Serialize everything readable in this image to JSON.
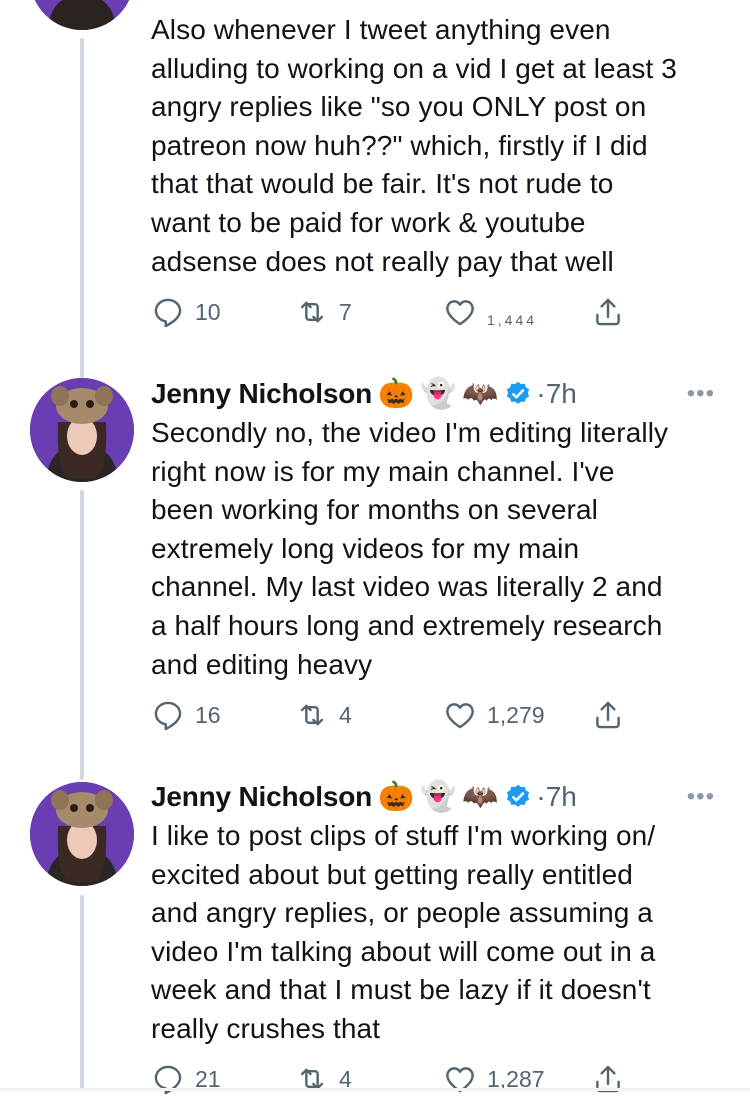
{
  "tweets": [
    {
      "body": "Also whenever I tweet anything even\nalluding to working on a vid I get at least 3\nangry replies like \"so you ONLY post on\npatreon now huh??\" which, firstly if I did\nthat that would be fair. It's not rude to\nwant to be paid for work & youtube\nadsense does not really pay that well",
      "replies": "10",
      "retweets": "7",
      "likes": "1,444"
    },
    {
      "author": "Jenny Nicholson",
      "emojis": [
        "🎃",
        "👻",
        "🦇"
      ],
      "time": "7h",
      "body": "Secondly no, the video I'm editing literally\nright now is for my main channel. I've\nbeen working for months on several\nextremely long videos for my main\nchannel. My last video was literally 2 and\na half hours long and extremely research\nand editing heavy",
      "replies": "16",
      "retweets": "4",
      "likes": "1,279"
    },
    {
      "author": "Jenny Nicholson",
      "emojis": [
        "🎃",
        "👻",
        "🦇"
      ],
      "time": "7h",
      "body": "I like to post clips of stuff I'm working on/\nexcited about but getting really entitled\nand angry replies, or people assuming a\nvideo I'm talking about will come out in a\nweek and that I must be lazy if it doesn't\nreally crushes that",
      "replies": "21",
      "retweets": "4",
      "likes": "1,287"
    }
  ],
  "separator": "·",
  "more_glyph": "•••",
  "colors": {
    "text": "#0f1419",
    "secondary": "#536471",
    "thread_line": "#cfd9de",
    "verified": "#1d9bf0",
    "avatar_bg": "#6a3db3"
  },
  "icons": [
    "reply-icon",
    "retweet-icon",
    "like-icon",
    "share-icon",
    "verified-badge-icon",
    "more-icon"
  ]
}
